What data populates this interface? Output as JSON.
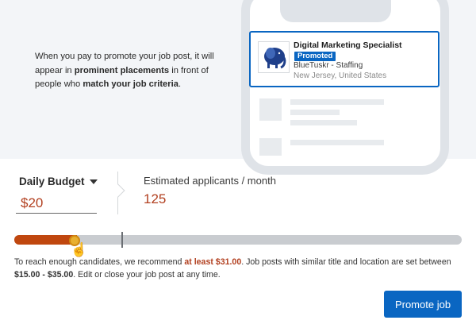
{
  "hero": {
    "text_pre": "When you pay to promote your job post, it will appear in ",
    "text_bold1": "prominent placements",
    "text_mid": " in front of people who ",
    "text_bold2": "match your job criteria",
    "text_end": "."
  },
  "job_card": {
    "title": "Digital Marketing Specialist",
    "badge": "Promoted",
    "company": "BlueTuskr - Staffing",
    "location": "New Jersey, United States",
    "logo_icon": "elephant-logo-icon"
  },
  "budget": {
    "label": "Daily Budget",
    "value": "$20"
  },
  "estimate": {
    "label": "Estimated applicants / month",
    "value": "125"
  },
  "slider": {
    "current_fraction": 0.14,
    "recommended_fraction": 0.24,
    "fill_color": "#c0470f",
    "track_color": "#c9ccd0"
  },
  "hint": {
    "pre": "To reach enough candidates, we recommend ",
    "recommend": "at least $31.00",
    "mid": ". Job posts with similar title and location are set between ",
    "range": "$15.00 - $35.00",
    "post": ". Edit or close your job post at any time."
  },
  "actions": {
    "promote_label": "Promote job"
  },
  "colors": {
    "accent": "#0a66c2",
    "value": "#b24020"
  }
}
